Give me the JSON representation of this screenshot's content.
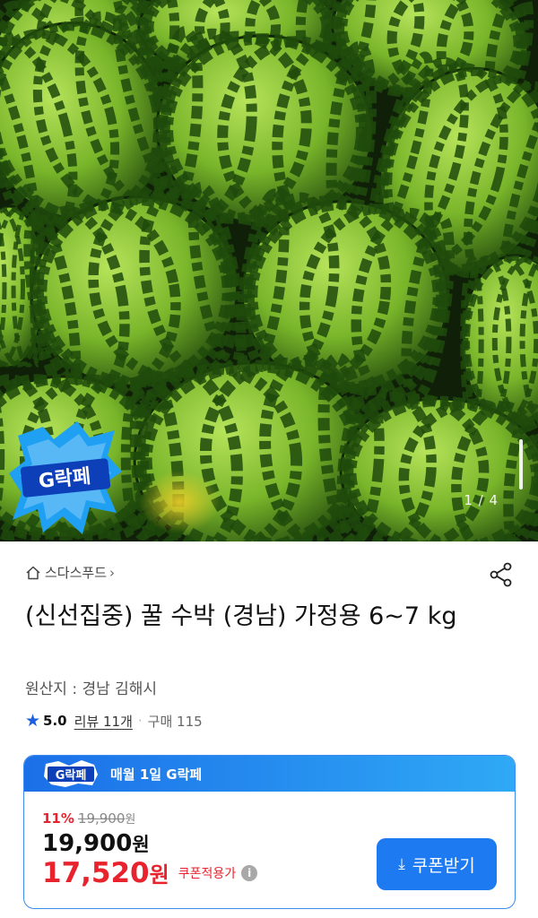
{
  "gallery": {
    "counter": "1 / 4",
    "badge_text": "G락페"
  },
  "seller": {
    "name": "스다스푸드",
    "chevron": "›"
  },
  "product": {
    "title": "(신선집중) 꿀 수박 (경남) 가정용 6~7 kg",
    "origin": "원산지 : 경남 김해시"
  },
  "rating": {
    "score": "5.0",
    "reviews": "리뷰 11개",
    "separator": "·",
    "purchases": "구매 115"
  },
  "promo": {
    "badge_text": "G락페",
    "header": "매월 1일 G락페",
    "discount_pct": "11%",
    "original_price": "19,900",
    "original_unit": "원",
    "price": "19,900",
    "price_unit": "원",
    "sale_price": "17,520",
    "sale_unit": "원",
    "sale_note": "쿠폰적용가",
    "info_icon": "i",
    "coupon_button": "쿠폰받기"
  },
  "colors": {
    "accent_blue": "#1d7af0",
    "sale_red": "#e8232e",
    "star_blue": "#1a5fe0"
  },
  "icons": [
    "home-icon",
    "share-icon",
    "star-icon",
    "info-icon",
    "download-icon"
  ]
}
